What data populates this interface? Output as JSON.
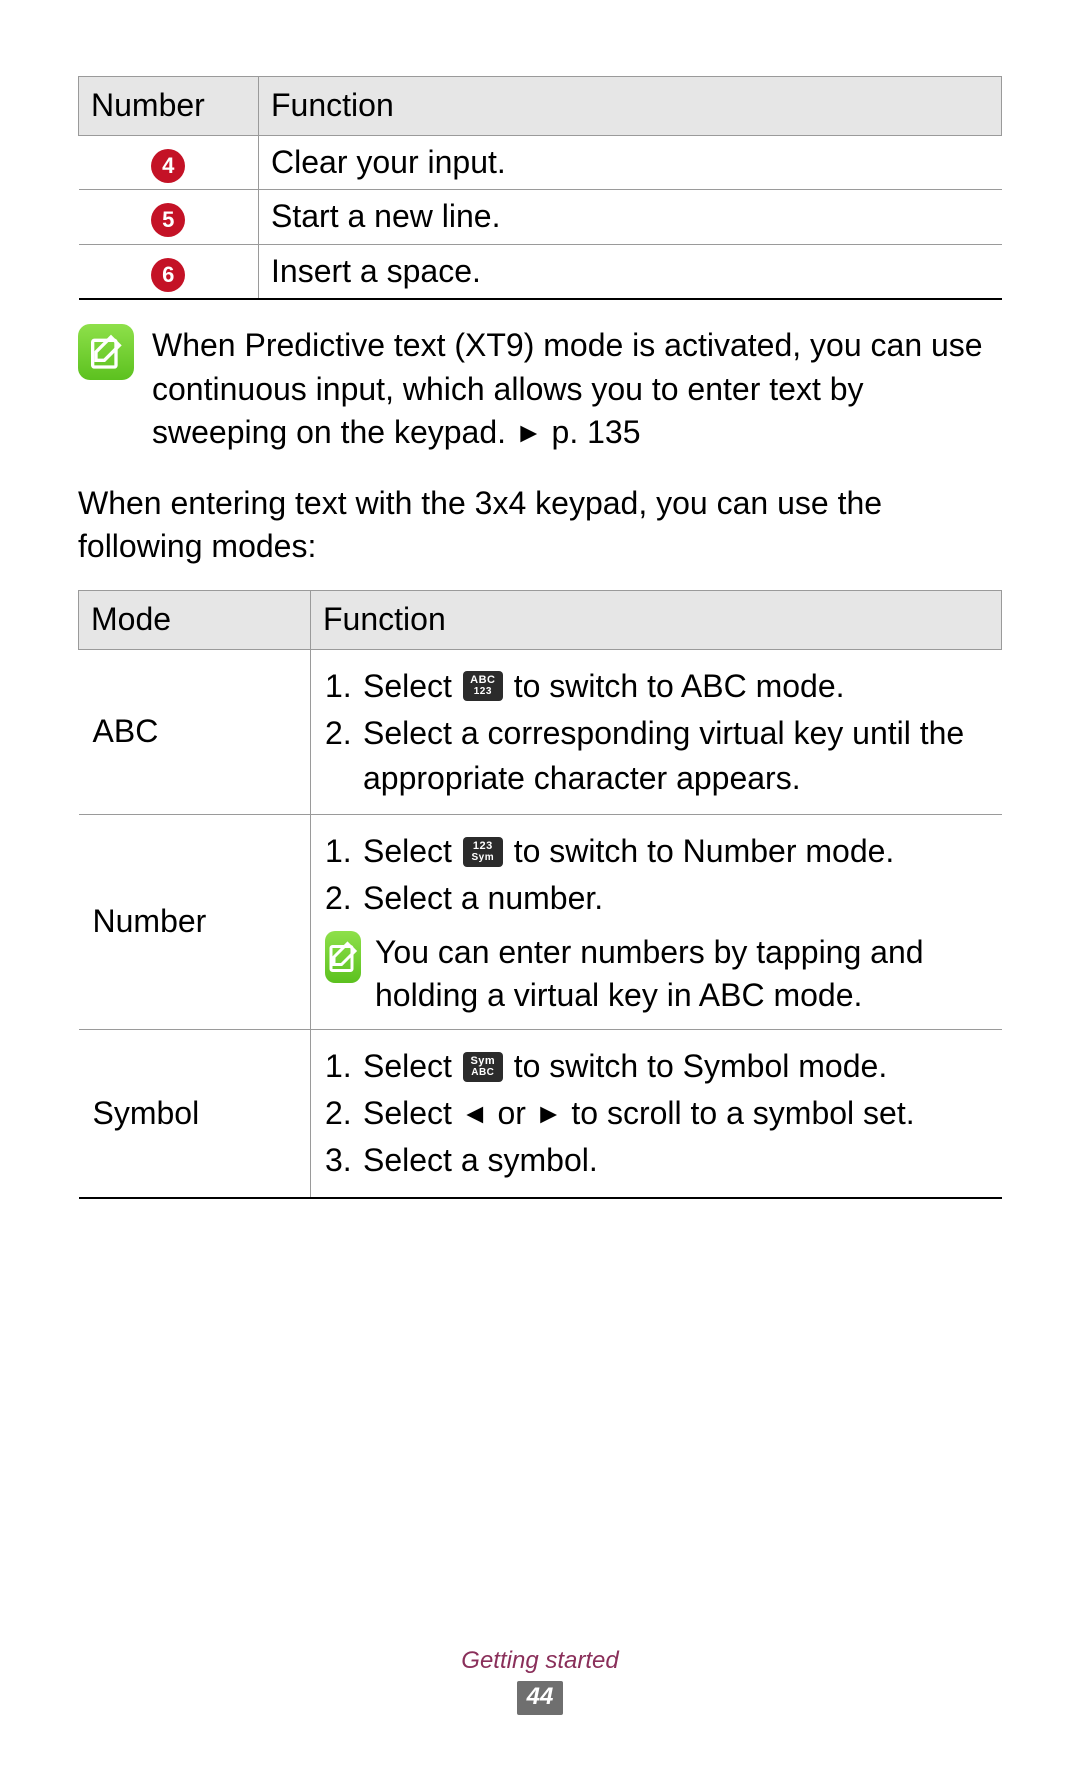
{
  "table1": {
    "headers": {
      "c1": "Number",
      "c2": "Function"
    },
    "rows": [
      {
        "num": "4",
        "fn": "Clear your input."
      },
      {
        "num": "5",
        "fn": "Start a new line."
      },
      {
        "num": "6",
        "fn": "Insert a space."
      }
    ]
  },
  "note1": {
    "text_a": "When Predictive text (XT9) mode is activated, you can use continuous input, which allows you to enter text by sweeping on the keypad. ",
    "arrow": "►",
    "text_b": " p. 135"
  },
  "para1": "When entering text with the 3x4 keypad, you can use the following modes:",
  "table2": {
    "headers": {
      "c1": "Mode",
      "c2": "Function"
    },
    "rows": {
      "abc": {
        "mode": "ABC",
        "li1_n": "1.",
        "li1_pre": "Select ",
        "li1_icon_top": "ABC",
        "li1_icon_bot": "123",
        "li1_post": " to switch to ABC mode.",
        "li2_n": "2.",
        "li2_txt": "Select a corresponding virtual key until the appropriate character appears."
      },
      "number": {
        "mode": "Number",
        "li1_n": "1.",
        "li1_pre": "Select ",
        "li1_icon_top": "123",
        "li1_icon_bot": "Sym",
        "li1_post": " to switch to Number mode.",
        "li2_n": "2.",
        "li2_txt": "Select a number.",
        "note": "You can enter numbers by tapping and holding a virtual key in ABC mode."
      },
      "symbol": {
        "mode": "Symbol",
        "li1_n": "1.",
        "li1_pre": "Select ",
        "li1_icon_top": "Sym",
        "li1_icon_bot": "ABC",
        "li1_post": " to switch to Symbol mode.",
        "li2_n": "2.",
        "li2_pre": "Select ",
        "li2_left": "◄",
        "li2_mid": " or ",
        "li2_right": "►",
        "li2_post": " to scroll to a symbol set.",
        "li3_n": "3.",
        "li3_txt": "Select a symbol."
      }
    }
  },
  "footer": {
    "section": "Getting started",
    "page": "44"
  }
}
